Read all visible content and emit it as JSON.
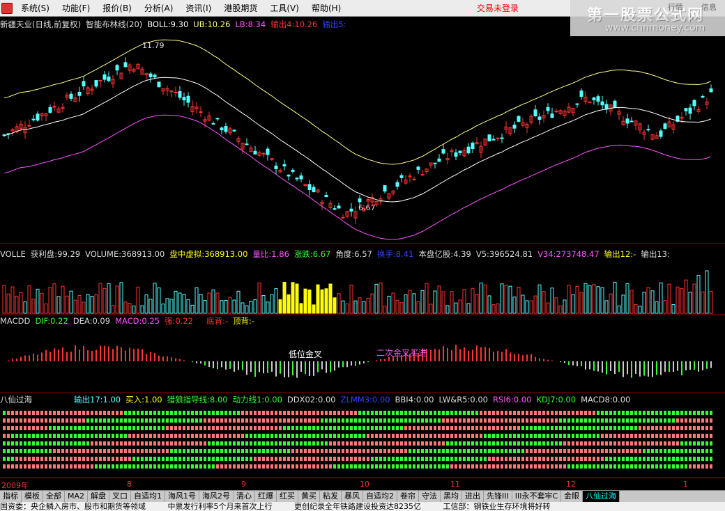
{
  "menu": {
    "items": [
      "系统(S)",
      "功能(F)",
      "报价(B)",
      "分析(A)",
      "资讯(I)",
      "港股期货",
      "工具(V)",
      "帮助(H)"
    ],
    "login_status": "交易未登录"
  },
  "brand": {
    "name": "第一股票公式网",
    "url": "www.chnmoney.com",
    "btn1": "行情",
    "btn2": "信息"
  },
  "main_panel": {
    "title": "新疆天业(日线,前复权)",
    "indicator": "智能布林线(20)",
    "boll": "BOLL:9.30",
    "ub": "UB:10.26",
    "lb": "LB:8.34",
    "out4": "输出4:10.26",
    "out5": "输出5:",
    "high_label": "11.79",
    "low_label": "6.67"
  },
  "vol_panel": {
    "name": "VOLLE",
    "profit": "获利盘:99.29",
    "volume": "VOLUME:368913.00",
    "virtual": "盘中虚拟:368913.00",
    "ratio": "量比:1.86",
    "change": "涨跌:6.67",
    "angle": "角度:6.57",
    "turnover": "换手:8.41",
    "shares": "本盘亿股:4.39",
    "v5": "V5:396524.81",
    "v34": "V34:273748.47",
    "out12": "输出12:-",
    "out13": "输出13:"
  },
  "macd_panel": {
    "name": "MACDD",
    "dif": "DIF:0.22",
    "dea": "DEA:0.09",
    "macd": "MACD:0.25",
    "strong": "强:0.22",
    "bottom_div": "底背:-",
    "top_div": "顶背:-",
    "annot1": "低位金叉",
    "annot2": "二次金叉买进"
  },
  "bx_panel": {
    "name": "八仙过海",
    "out17": "输出17:1.00",
    "buy": "买入:1.00",
    "hunter": "猎狼指导线:8.00",
    "power": "动力线1:0.00",
    "ddx": "DDX02:0.00",
    "zlmm": "ZLMM3:0.00",
    "bbi": "BBI4:0.00",
    "lwr": "LW&R5:0.00",
    "rsi": "RSI6:0.00",
    "kdj": "KDJ7:0.00",
    "macd8": "MACD8:0.00"
  },
  "x_axis": [
    "2009年",
    "8",
    "9",
    "10",
    "11",
    "12",
    "1"
  ],
  "tabs": [
    "指标",
    "模板",
    "全部",
    "MA2",
    "解盘",
    "叉口",
    "自适均1",
    "海风1号",
    "海风2号",
    "清心",
    "红爆",
    "红买",
    "黄买",
    "粘发",
    "暴风",
    "自适均2",
    "卷帘",
    "守法",
    "黑均",
    "进出",
    "先锋III",
    "III永不套牢C",
    "金眼",
    "八仙过海"
  ],
  "active_tab": "八仙过海",
  "ticker": [
    "国资委：央企鳞入房市、股市和期货等领域",
    "中票发行利率5个月来首次上行",
    "更创纪录全年铁路建设投资达8235亿",
    "工信部：钢铁业生存环境将好转"
  ],
  "colors": {
    "up": "#ff3333",
    "down": "#55ffff",
    "boll_mid": "#ffffff",
    "ub": "#ffff88",
    "lb": "#ff55ff",
    "green": "#33ff33",
    "yellow": "#ffff00"
  }
}
